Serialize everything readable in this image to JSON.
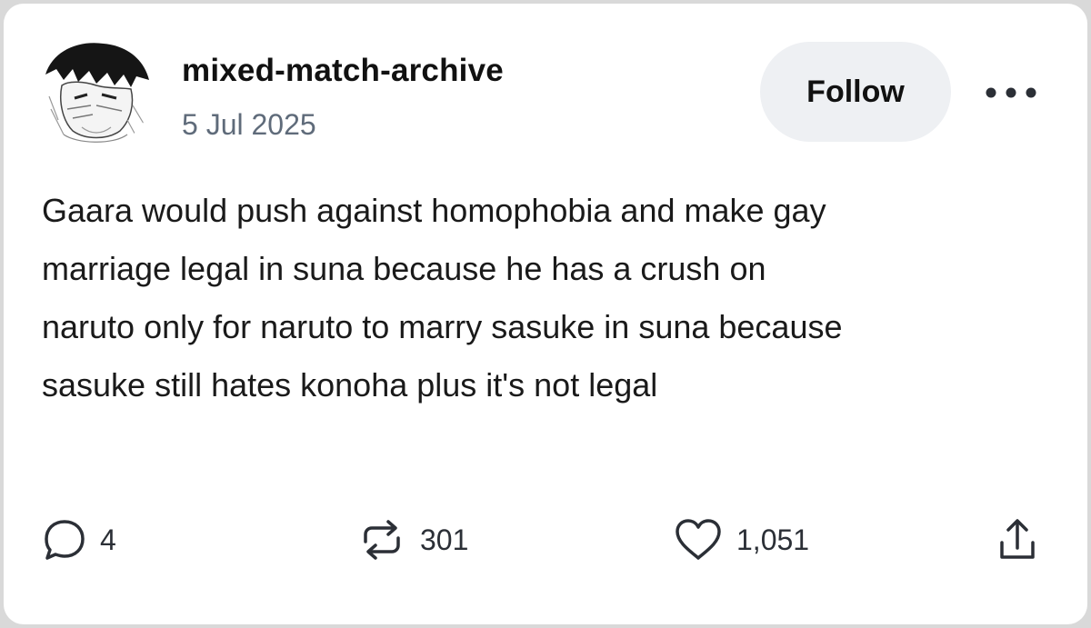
{
  "post": {
    "author": {
      "username": "mixed-match-archive",
      "avatar": "manga-character-avatar"
    },
    "date": "5 Jul 2025",
    "follow_label": "Follow",
    "more_icon": "more-options-icon",
    "body": "Gaara would push against homophobia and make gay\nmarriage legal in suna because he has a crush on\nnaruto only for naruto to marry sasuke in suna because\nsasuke still hates konoha plus it's not legal"
  },
  "actions": {
    "comments": {
      "icon": "comment-icon",
      "count": "4"
    },
    "reblogs": {
      "icon": "reblog-icon",
      "count": "301"
    },
    "likes": {
      "icon": "heart-icon",
      "count": "1,051"
    },
    "share": {
      "icon": "share-icon"
    }
  },
  "colors": {
    "text": "#111111",
    "muted": "#5f6b7a",
    "button_bg": "#eef0f3",
    "icon": "#2b2f36"
  }
}
